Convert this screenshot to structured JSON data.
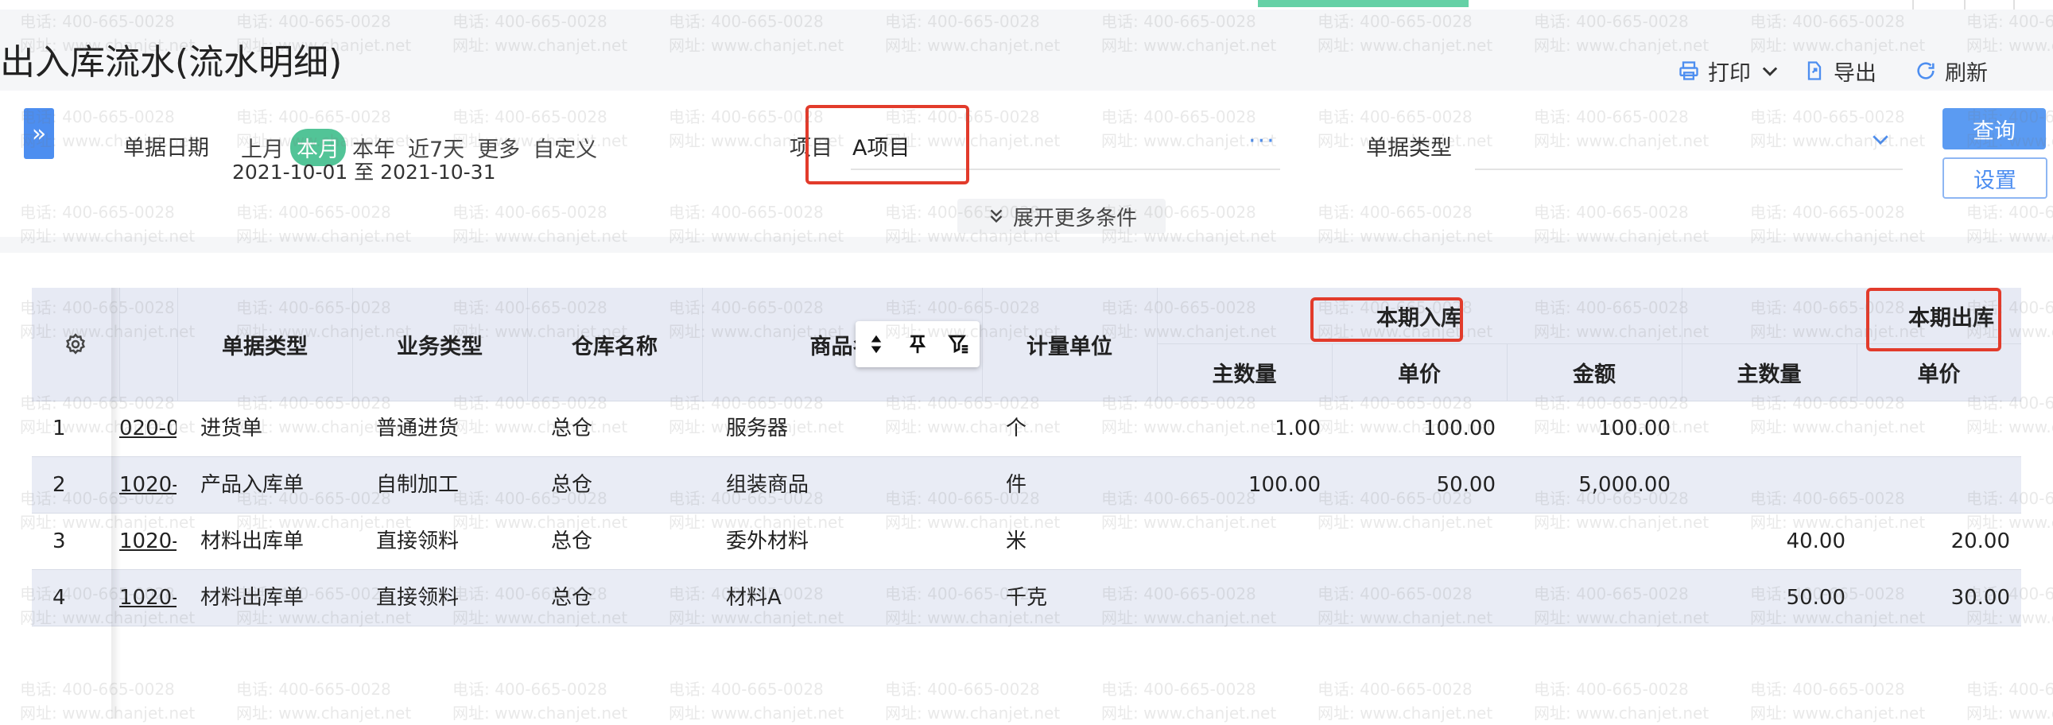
{
  "page": {
    "title": "出入库流水(流水明细)"
  },
  "toolbar": {
    "print_label": "打印",
    "export_label": "导出",
    "refresh_label": "刷新"
  },
  "filters": {
    "date_label": "单据日期",
    "date_chips": [
      "上月",
      "本月",
      "本年",
      "近7天",
      "更多",
      "自定义"
    ],
    "active_chip": "本月",
    "date_range": "2021-10-01 至 2021-10-31",
    "project_label": "项目",
    "project_value": "A项目",
    "doc_type_label": "单据类型",
    "doc_type_value": "",
    "expand_label": "展开更多条件",
    "query_label": "查询",
    "settings_label": "设置"
  },
  "watermark": {
    "phone": "电话: 400-665-0028",
    "site": "网址: www.chanjet.net"
  },
  "table": {
    "headers": {
      "doc_type": "单据类型",
      "biz_type": "业务类型",
      "warehouse": "仓库名称",
      "product": "商品名",
      "unit": "计量单位",
      "in_group": "本期入库",
      "out_group": "本期出库",
      "in_qty": "主数量",
      "in_price": "单价",
      "in_amount": "金额",
      "out_qty": "主数量",
      "out_price": "单价"
    },
    "rows": [
      {
        "no": "1",
        "code": "020-0",
        "doc_type": "进货单",
        "biz_type": "普通进货",
        "warehouse": "总仓",
        "product": "服务器",
        "unit": "个",
        "in_qty": "1.00",
        "in_price": "100.00",
        "in_amount": "100.00",
        "out_qty": "",
        "out_price": ""
      },
      {
        "no": "2",
        "code": "1020-",
        "doc_type": "产品入库单",
        "biz_type": "自制加工",
        "warehouse": "总仓",
        "product": "组装商品",
        "unit": "件",
        "in_qty": "100.00",
        "in_price": "50.00",
        "in_amount": "5,000.00",
        "out_qty": "",
        "out_price": ""
      },
      {
        "no": "3",
        "code": "1020-",
        "doc_type": "材料出库单",
        "biz_type": "直接领料",
        "warehouse": "总仓",
        "product": "委外材料",
        "unit": "米",
        "in_qty": "",
        "in_price": "",
        "in_amount": "",
        "out_qty": "40.00",
        "out_price": "20.00"
      },
      {
        "no": "4",
        "code": "1020-",
        "doc_type": "材料出库单",
        "biz_type": "直接领料",
        "warehouse": "总仓",
        "product": "材料A",
        "unit": "千克",
        "in_qty": "",
        "in_price": "",
        "in_amount": "",
        "out_qty": "50.00",
        "out_price": "30.00"
      }
    ]
  },
  "colors": {
    "accent": "#4d8ef0",
    "active_chip": "#52c497",
    "header_bg": "#e7eaf4",
    "highlight": "#e23b2b"
  },
  "icons": [
    "printer-icon",
    "export-icon",
    "refresh-icon",
    "expand-sidebar-icon",
    "more-dots-icon",
    "chevron-down-icon",
    "gear-icon",
    "sort-icon",
    "pin-icon",
    "filter-icon"
  ]
}
